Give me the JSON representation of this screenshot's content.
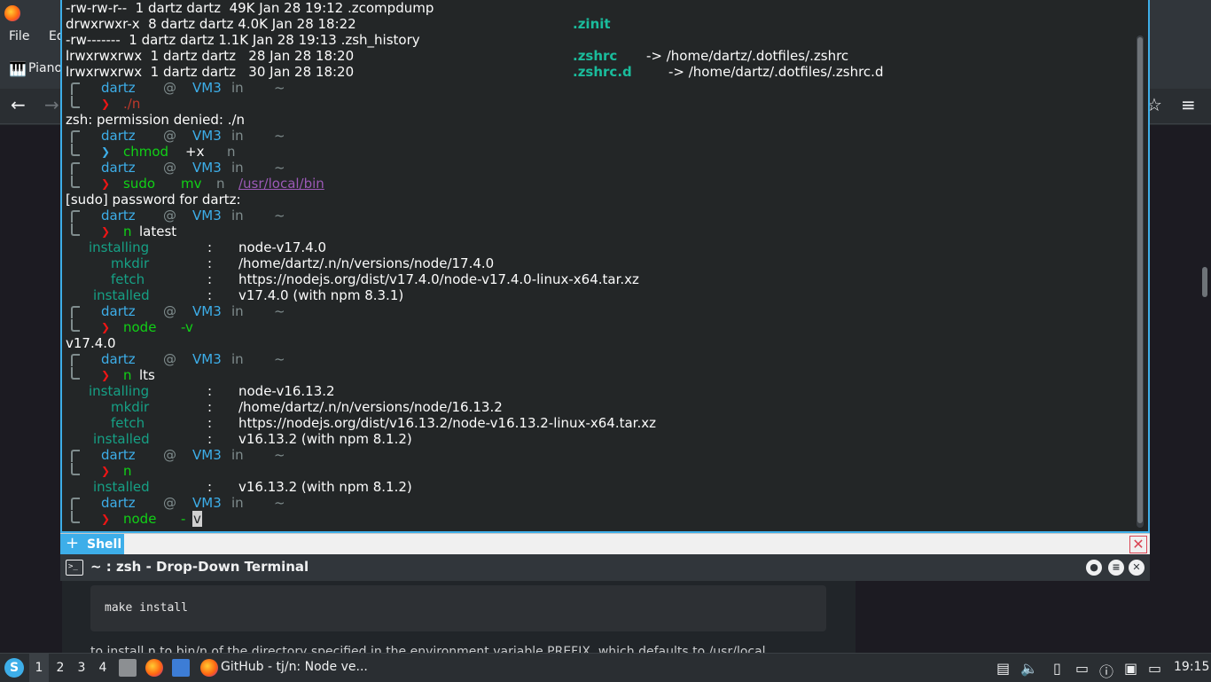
{
  "browser": {
    "menu": {
      "file": "File",
      "edit_partial": "Ed"
    },
    "bookmark_label": "Piano",
    "code_block": "make install",
    "partial_text": "to install n to bin/n of the directory specified in the environment variable PREFIX, which defaults to /usr/local"
  },
  "terminal": {
    "tab_label": "Shell",
    "title": "~ : zsh - Drop-Down Terminal",
    "lines": [
      {
        "t": "plain",
        "parts": [
          "-rw-rw-r--  1 dartz dartz  49K Jan 28 19:12 .zcompdump"
        ]
      },
      {
        "t": "plain",
        "parts": [
          "drwxrwxr-x  8 dartz dartz 4.0K Jan 28 18:22"
        ],
        "right": ".zinit"
      },
      {
        "t": "plain",
        "parts": [
          "-rw-------  1 dartz dartz 1.1K Jan 28 19:13 .zsh_history"
        ]
      },
      {
        "t": "link",
        "parts": [
          "lrwxrwxrwx  1 dartz dartz   28 Jan 28 18:20"
        ],
        "name": ".zshrc",
        "target": "-> /home/dartz/.dotfiles/.zshrc"
      },
      {
        "t": "link",
        "parts": [
          "lrwxrwxrwx  1 dartz dartz   30 Jan 28 18:20"
        ],
        "name": ".zshrc.d",
        "target": "-> /home/dartz/.dotfiles/.zshrc.d"
      }
    ],
    "prompt": {
      "user": "dartz",
      "at": "@",
      "host": "VM3",
      "in": "in",
      "dir": "~"
    },
    "cmd1": "./n",
    "err1": "zsh: permission denied: ./n",
    "cmd2": {
      "cmd": "chmod",
      "arg1": "+x",
      "arg2": "n"
    },
    "cmd3": {
      "cmd": "sudo",
      "arg1": "mv",
      "arg2": "n",
      "arg3": "/usr/local/bin"
    },
    "sudo_prompt": "[sudo] password for dartz:",
    "cmd4": {
      "cmd": "n",
      "arg1": "latest"
    },
    "install1": [
      {
        "k": "installing",
        "v": "node-v17.4.0"
      },
      {
        "k": "mkdir",
        "v": "/home/dartz/.n/n/versions/node/17.4.0"
      },
      {
        "k": "fetch",
        "v": "https://nodejs.org/dist/v17.4.0/node-v17.4.0-linux-x64.tar.xz"
      },
      {
        "k": "installed",
        "v": "v17.4.0 (with npm 8.3.1)"
      }
    ],
    "cmd5": {
      "cmd": "node",
      "arg1": "-v"
    },
    "out5": "v17.4.0",
    "cmd6": {
      "cmd": "n",
      "arg1": "lts"
    },
    "install2": [
      {
        "k": "installing",
        "v": "node-v16.13.2"
      },
      {
        "k": "mkdir",
        "v": "/home/dartz/.n/n/versions/node/16.13.2"
      },
      {
        "k": "fetch",
        "v": "https://nodejs.org/dist/v16.13.2/node-v16.13.2-linux-x64.tar.xz"
      },
      {
        "k": "installed",
        "v": "v16.13.2 (with npm 8.1.2)"
      }
    ],
    "cmd7": {
      "cmd": "n"
    },
    "out7": {
      "k": "installed",
      "v": "v16.13.2 (with npm 8.1.2)"
    },
    "cmd8": {
      "cmd": "node",
      "arg1": "-",
      "cursor": "v"
    },
    "sep": ":"
  },
  "taskbar": {
    "desktops": [
      "1",
      "2",
      "3",
      "4"
    ],
    "active_task": "GitHub - tj/n: Node ve...",
    "clock": "19:15"
  },
  "colors": {
    "accent": "#3daee9",
    "terminal_bg": "#232627",
    "close": "#da4453"
  }
}
